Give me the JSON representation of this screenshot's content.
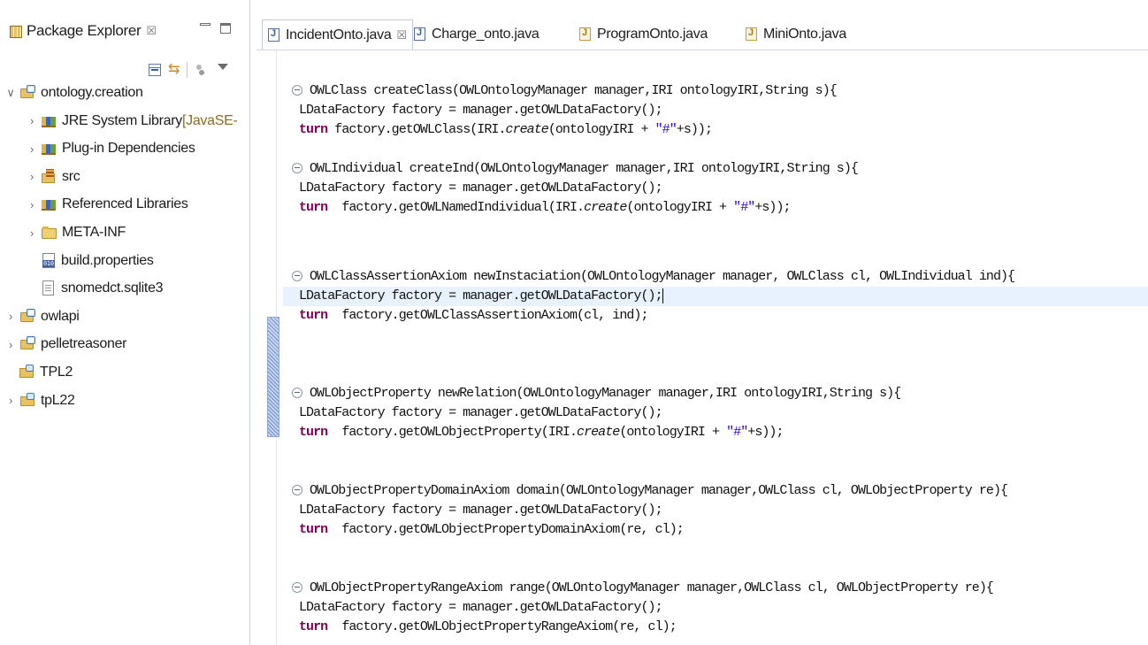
{
  "package_explorer": {
    "title": "Package Explorer",
    "close_glyph": "☒",
    "toolbar": {
      "collapse_all": "collapse-all-icon",
      "link_with_editor": "link-with-editor-icon",
      "focus": "focus-icon",
      "view_menu": "view-menu-icon"
    },
    "tree": [
      {
        "label": "ontology.creation",
        "decoration": "",
        "twisty": "v",
        "icon": "java-project-icon"
      },
      {
        "label": "JRE System Library",
        "decoration": " [JavaSE-",
        "twisty": ">",
        "icon": "library-icon"
      },
      {
        "label": "Plug-in Dependencies",
        "decoration": "",
        "twisty": ">",
        "icon": "library-icon"
      },
      {
        "label": "src",
        "decoration": "",
        "twisty": ">",
        "icon": "source-folder-icon"
      },
      {
        "label": "Referenced Libraries",
        "decoration": "",
        "twisty": ">",
        "icon": "library-icon"
      },
      {
        "label": "META-INF",
        "decoration": "",
        "twisty": ">",
        "icon": "folder-icon"
      },
      {
        "label": "build.properties",
        "decoration": "",
        "twisty": "",
        "icon": "properties-file-icon"
      },
      {
        "label": "snomedct.sqlite3",
        "decoration": "",
        "twisty": "",
        "icon": "file-icon"
      },
      {
        "label": "owlapi",
        "decoration": "",
        "twisty": ">",
        "icon": "java-project-icon"
      },
      {
        "label": "pelletreasoner",
        "decoration": "",
        "twisty": ">",
        "icon": "java-project-icon"
      },
      {
        "label": "TPL2",
        "decoration": "",
        "twisty": "",
        "icon": "closed-project-icon"
      },
      {
        "label": "tpL22",
        "decoration": "",
        "twisty": ">",
        "icon": "closed-project-icon"
      }
    ]
  },
  "editor": {
    "tabs": [
      {
        "label": "IncidentOnto.java",
        "active": true,
        "close": "☒"
      },
      {
        "label": "Charge_onto.java",
        "active": false,
        "close": ""
      },
      {
        "label": "ProgramOnto.java",
        "active": false,
        "close": ""
      },
      {
        "label": "MiniOnto.java",
        "active": false,
        "close": ""
      }
    ],
    "code": [
      {
        "fold": true,
        "parts": [
          [
            "t",
            "OWLClass createClass(OWLOntologyManager manager,IRI ontologyIRI,String s){"
          ]
        ]
      },
      {
        "fold": false,
        "parts": [
          [
            "t",
            "LDataFactory factory = manager.getOWLDataFactory();"
          ]
        ]
      },
      {
        "fold": false,
        "parts": [
          [
            "kw",
            "turn"
          ],
          [
            "t",
            " factory.getOWLClass(IRI."
          ],
          [
            "it",
            "create"
          ],
          [
            "t",
            "(ontologyIRI + "
          ],
          [
            "str",
            "\"#\""
          ],
          [
            "t",
            "+s));"
          ]
        ]
      },
      {
        "fold": false,
        "parts": []
      },
      {
        "fold": true,
        "parts": [
          [
            "t",
            "OWLIndividual createInd(OWLOntologyManager manager,IRI ontologyIRI,String s){"
          ]
        ]
      },
      {
        "fold": false,
        "parts": [
          [
            "t",
            "LDataFactory factory = manager.getOWLDataFactory();"
          ]
        ]
      },
      {
        "fold": false,
        "parts": [
          [
            "kw",
            "turn"
          ],
          [
            "t",
            "  factory.getOWLNamedIndividual(IRI."
          ],
          [
            "it",
            "create"
          ],
          [
            "t",
            "(ontologyIRI + "
          ],
          [
            "str",
            "\"#\""
          ],
          [
            "t",
            "+s));"
          ]
        ]
      },
      {
        "fold": false,
        "parts": []
      },
      {
        "fold": true,
        "parts": [
          [
            "t",
            "OWLClassAssertionAxiom newInstaciation(OWLOntologyManager manager, OWLClass cl, OWLIndividual ind){"
          ]
        ]
      },
      {
        "fold": false,
        "current": true,
        "parts": [
          [
            "t",
            "LDataFactory factory = manager.getOWLDataFactory();"
          ],
          [
            "caret",
            ""
          ]
        ]
      },
      {
        "fold": false,
        "parts": [
          [
            "kw",
            "turn"
          ],
          [
            "t",
            "  factory.getOWLClassAssertionAxiom(cl, ind);"
          ]
        ]
      },
      {
        "fold": false,
        "parts": []
      },
      {
        "fold": false,
        "parts": []
      },
      {
        "fold": true,
        "parts": [
          [
            "t",
            "OWLObjectProperty newRelation(OWLOntologyManager manager,IRI ontologyIRI,String s){"
          ]
        ]
      },
      {
        "fold": false,
        "parts": [
          [
            "t",
            "LDataFactory factory = manager.getOWLDataFactory();"
          ]
        ]
      },
      {
        "fold": false,
        "parts": [
          [
            "kw",
            "turn"
          ],
          [
            "t",
            "  factory.getOWLObjectProperty(IRI."
          ],
          [
            "it",
            "create"
          ],
          [
            "t",
            "(ontologyIRI + "
          ],
          [
            "str",
            "\"#\""
          ],
          [
            "t",
            "+s));"
          ]
        ]
      },
      {
        "fold": false,
        "parts": []
      },
      {
        "fold": true,
        "parts": [
          [
            "t",
            "OWLObjectPropertyDomainAxiom domain(OWLOntologyManager manager,OWLClass cl, OWLObjectProperty re){"
          ]
        ]
      },
      {
        "fold": false,
        "parts": [
          [
            "t",
            "LDataFactory factory = manager.getOWLDataFactory();"
          ]
        ]
      },
      {
        "fold": false,
        "parts": [
          [
            "kw",
            "turn"
          ],
          [
            "t",
            "  factory.getOWLObjectPropertyDomainAxiom(re, cl);"
          ]
        ]
      },
      {
        "fold": false,
        "parts": []
      },
      {
        "fold": true,
        "parts": [
          [
            "t",
            "OWLObjectPropertyRangeAxiom range(OWLOntologyManager manager,OWLClass cl, OWLObjectProperty re){"
          ]
        ]
      },
      {
        "fold": false,
        "parts": [
          [
            "t",
            "LDataFactory factory = manager.getOWLDataFactory();"
          ]
        ]
      },
      {
        "fold": false,
        "parts": [
          [
            "kw",
            "turn"
          ],
          [
            "t",
            "  factory.getOWLObjectPropertyRangeAxiom(re, cl);"
          ]
        ]
      }
    ]
  },
  "colors": {
    "keyword": "#7f0055",
    "string": "#2a00ff",
    "current_line": "#e8f2fe",
    "decoration": "#8f6a1f"
  }
}
